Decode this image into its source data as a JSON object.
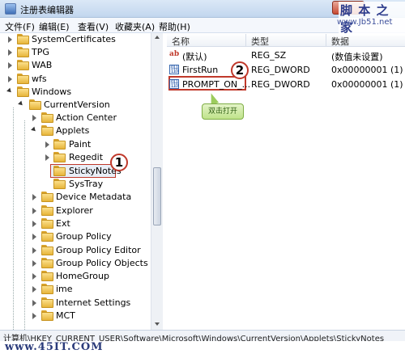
{
  "titlebar": {
    "title": "注册表编辑器",
    "close_label": "✕"
  },
  "watermark": {
    "brand": "脚 本 之 家",
    "url": "www.Jb51.net",
    "footer": "www.45IT.COM"
  },
  "menubar": [
    "文件(F)",
    "编辑(E)",
    "查看(V)",
    "收藏夹(A)",
    "帮助(H)"
  ],
  "tree": {
    "items": [
      {
        "label": "SystemCertificates"
      },
      {
        "label": "TPG"
      },
      {
        "label": "WAB"
      },
      {
        "label": "wfs"
      },
      {
        "label": "Windows"
      },
      {
        "label": "CurrentVersion"
      },
      {
        "label": "Action Center"
      },
      {
        "label": "Applets"
      },
      {
        "label": "Paint"
      },
      {
        "label": "Regedit"
      },
      {
        "label": "StickyNotes"
      },
      {
        "label": "SysTray"
      },
      {
        "label": "Device Metadata"
      },
      {
        "label": "Explorer"
      },
      {
        "label": "Ext"
      },
      {
        "label": "Group Policy"
      },
      {
        "label": "Group Policy Editor"
      },
      {
        "label": "Group Policy Objects"
      },
      {
        "label": "HomeGroup"
      },
      {
        "label": "ime"
      },
      {
        "label": "Internet Settings"
      },
      {
        "label": "MCT"
      }
    ]
  },
  "list": {
    "columns": [
      "名称",
      "类型",
      "数据"
    ],
    "rows": [
      {
        "name": "(默认)",
        "type": "REG_SZ",
        "data": "(数值未设置)",
        "icon": "string-value-icon"
      },
      {
        "name": "FirstRun",
        "type": "REG_DWORD",
        "data": "0x00000001 (1)",
        "icon": "dword-value-icon"
      },
      {
        "name": "PROMPT_ON_...",
        "type": "REG_DWORD",
        "data": "0x00000001 (1)",
        "icon": "dword-value-icon"
      }
    ]
  },
  "annotations": {
    "step1": "1",
    "step2": "2",
    "callout": "双击打开"
  },
  "statusbar": {
    "path": "计算机\\HKEY_CURRENT_USER\\Software\\Microsoft\\Windows\\CurrentVersion\\Applets\\StickyNotes"
  },
  "colors": {
    "accent_red": "#c0392b",
    "callout_green": "#bfe38a",
    "folder_yellow": "#f3c95a"
  }
}
